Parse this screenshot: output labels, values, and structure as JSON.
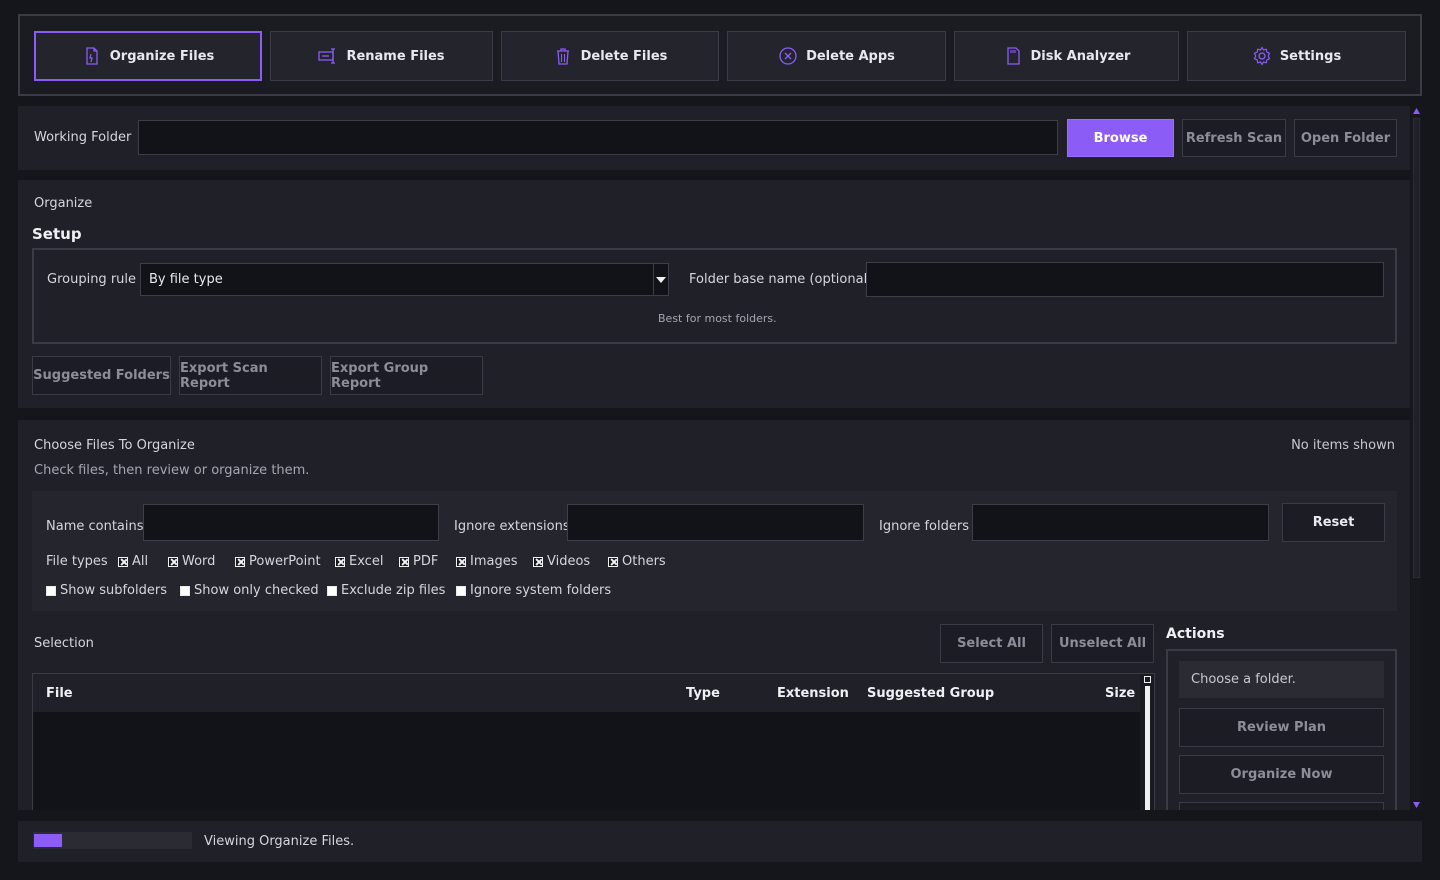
{
  "nav": {
    "tabs": [
      {
        "label": "Organize Files",
        "icon": "organize-files-icon",
        "active": true
      },
      {
        "label": "Rename Files",
        "icon": "rename-icon"
      },
      {
        "label": "Delete Files",
        "icon": "trash-icon"
      },
      {
        "label": "Delete Apps",
        "icon": "circle-x-icon"
      },
      {
        "label": "Disk Analyzer",
        "icon": "sd-card-icon"
      },
      {
        "label": "Settings",
        "icon": "gear-icon"
      }
    ]
  },
  "working_folder": {
    "label": "Working Folder",
    "value": "",
    "browse": "Browse",
    "refresh": "Refresh Scan",
    "open": "Open Folder"
  },
  "organize": {
    "section": "Organize",
    "title": "Setup",
    "grouping_label": "Grouping rule",
    "grouping_value": "By file type",
    "folder_base_label": "Folder base name (optional)",
    "folder_base_value": "",
    "hint": "Best for most folders.",
    "buttons": {
      "suggested": "Suggested Folders",
      "export_scan": "Export Scan Report",
      "export_group": "Export Group Report"
    }
  },
  "choose": {
    "title": "Choose Files To Organize",
    "subtitle": "Check files, then review or organize them.",
    "count": "No items shown",
    "name_contains_label": "Name contains",
    "ignore_ext_label": "Ignore extensions",
    "ignore_folders_label": "Ignore folders",
    "reset": "Reset",
    "file_types_label": "File types",
    "file_types": [
      {
        "label": "All",
        "checked": true
      },
      {
        "label": "Word",
        "checked": true
      },
      {
        "label": "PowerPoint",
        "checked": true
      },
      {
        "label": "Excel",
        "checked": true
      },
      {
        "label": "PDF",
        "checked": true
      },
      {
        "label": "Images",
        "checked": true
      },
      {
        "label": "Videos",
        "checked": true
      },
      {
        "label": "Others",
        "checked": true
      }
    ],
    "options": [
      {
        "label": "Show subfolders",
        "checked": false
      },
      {
        "label": "Show only checked",
        "checked": false
      },
      {
        "label": "Exclude zip files",
        "checked": false
      },
      {
        "label": "Ignore system folders",
        "checked": false
      }
    ]
  },
  "selection": {
    "label": "Selection",
    "select_all": "Select All",
    "unselect_all": "Unselect All",
    "columns": [
      "File",
      "Type",
      "Extension",
      "Suggested Group",
      "Size"
    ],
    "rows": []
  },
  "actions": {
    "title": "Actions",
    "status": "Choose a folder.",
    "review": "Review Plan",
    "organize_now": "Organize Now"
  },
  "status_bar": {
    "text": "Viewing Organize Files.",
    "progress": 0.18
  },
  "colors": {
    "accent": "#8b5cf6",
    "background": "#15161c",
    "panel": "#1f2028"
  }
}
